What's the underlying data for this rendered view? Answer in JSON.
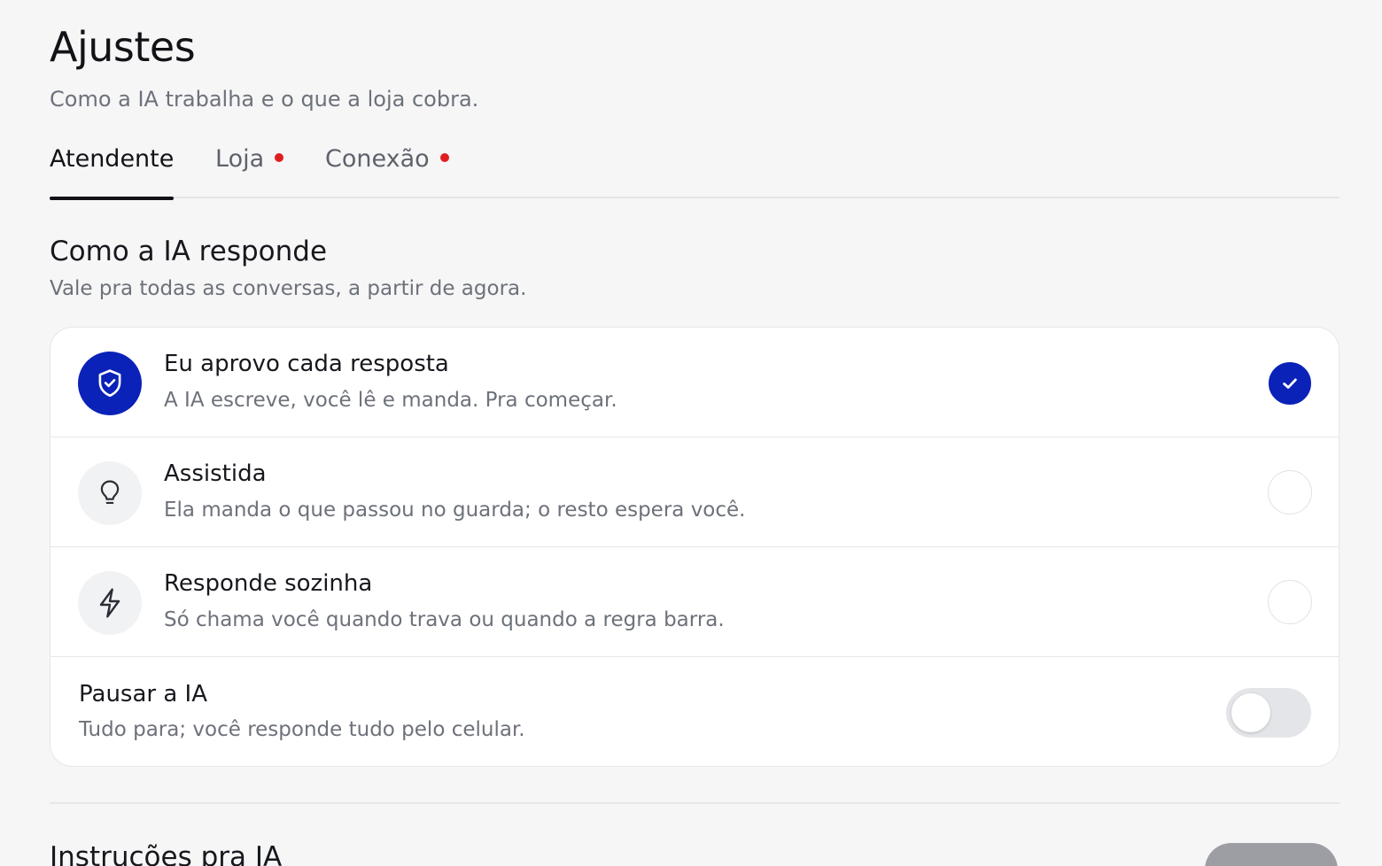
{
  "page": {
    "title": "Ajustes",
    "subtitle": "Como a IA trabalha e o que a loja cobra."
  },
  "tabs": [
    {
      "label": "Atendente",
      "active": true,
      "has_alert_dot": false
    },
    {
      "label": "Loja",
      "active": false,
      "has_alert_dot": true
    },
    {
      "label": "Conexão",
      "active": false,
      "has_alert_dot": true
    }
  ],
  "section": {
    "title": "Como a IA responde",
    "subtitle": "Vale pra todas as conversas, a partir de agora."
  },
  "modes": [
    {
      "icon": "shield-check-icon",
      "title": "Eu aprovo cada resposta",
      "description": "A IA escreve, você lê e manda. Pra começar.",
      "selected": true
    },
    {
      "icon": "lightbulb-icon",
      "title": "Assistida",
      "description": "Ela manda o que passou no guarda; o resto espera você.",
      "selected": false
    },
    {
      "icon": "lightning-bolt-icon",
      "title": "Responde sozinha",
      "description": "Só chama você quando trava ou quando a regra barra.",
      "selected": false
    }
  ],
  "pause": {
    "title": "Pausar a IA",
    "description": "Tudo para; você responde tudo pelo celular.",
    "enabled": false
  },
  "next_section": {
    "title": "Instruções pra IA"
  },
  "colors": {
    "accent": "#0a22b8",
    "alert_dot": "#e01e1e",
    "page_bg": "#f6f6f7"
  }
}
